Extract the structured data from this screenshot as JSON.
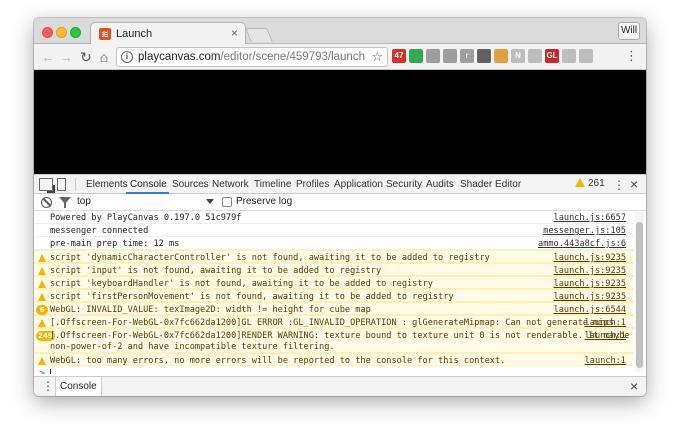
{
  "window": {
    "tab_title": "Launch",
    "tab_close": "×",
    "favicon_glyph": "≋",
    "profile_name": "Will"
  },
  "toolbar": {
    "back_glyph": "←",
    "forward_glyph": "→",
    "reload_glyph": "↻",
    "home_glyph": "⌂",
    "url_host": "playcanvas.com",
    "url_path": "/editor/scene/459793/launch",
    "star_glyph": "☆",
    "menu_glyph": "⋮",
    "info_glyph": "i",
    "extensions": [
      {
        "name": "gmail-ext-icon",
        "label": "47",
        "color": "#d93025"
      },
      {
        "name": "location-ext-icon",
        "label": "",
        "color": "#34a853"
      },
      {
        "name": "cast-ext-icon",
        "label": "",
        "color": "#9e9e9e"
      },
      {
        "name": "chat-ext-icon",
        "label": "",
        "color": "#9e9e9e"
      },
      {
        "name": "r-ext-icon",
        "label": "r",
        "color": "#9e9e9e"
      },
      {
        "name": "square-ext-icon",
        "label": "",
        "color": "#616161"
      },
      {
        "name": "speed-ext-icon",
        "label": "",
        "color": "#e0a040"
      },
      {
        "name": "n-ext-icon",
        "label": "N",
        "color": "#bdbdbd"
      },
      {
        "name": "box-ext-icon",
        "label": "",
        "color": "#bdbdbd"
      },
      {
        "name": "gl-ext-icon",
        "label": "GL",
        "color": "#c62828"
      },
      {
        "name": "grid-ext-icon",
        "label": "",
        "color": "#bdbdbd"
      },
      {
        "name": "link-ext-icon",
        "label": "",
        "color": "#bdbdbd"
      }
    ]
  },
  "devtools": {
    "tabs": [
      "Elements",
      "Console",
      "Sources",
      "Network",
      "Timeline",
      "Profiles",
      "Application",
      "Security",
      "Audits",
      "Shader Editor"
    ],
    "active_tab": "Console",
    "warning_count": "261",
    "more_glyph": "⋮",
    "close_glyph": "×"
  },
  "filter": {
    "context": "top",
    "preserve_log_label": "Preserve log"
  },
  "console": {
    "messages": [
      {
        "level": "info",
        "text": "Powered by PlayCanvas 0.197.0 51c979f",
        "source": "launch.js:6657"
      },
      {
        "level": "info",
        "text": "messenger connected",
        "source": "messenger.js:105"
      },
      {
        "level": "info",
        "text": "pre-main prep time: 12 ms",
        "source": "ammo.443a8cf.js:6"
      },
      {
        "level": "warn",
        "text": "script 'dynamicCharacterController' is not found, awaiting it to be added to registry",
        "source": "launch.js:9235"
      },
      {
        "level": "warn",
        "text": "script 'input' is not found, awaiting it to be added to registry",
        "source": "launch.js:9235"
      },
      {
        "level": "warn",
        "text": "script 'keyboardHandler' is not found, awaiting it to be added to registry",
        "source": "launch.js:9235"
      },
      {
        "level": "warn",
        "text": "script 'firstPersonMovement' is not found, awaiting it to be added to registry",
        "source": "launch.js:9235"
      },
      {
        "level": "warn",
        "badge": "6",
        "text": "WebGL: INVALID_VALUE: texImage2D: width != height for cube map",
        "source": "launch.js:6544"
      },
      {
        "level": "warn",
        "text": "[.Offscreen-For-WebGL-0x7fc662da1200]GL ERROR :GL_INVALID_OPERATION : glGenerateMipmap: Can not generate mips",
        "source": "launch:1"
      },
      {
        "level": "warn",
        "badge": "249",
        "text": "[.Offscreen-For-WebGL-0x7fc662da1200]RENDER WARNING: texture bound to texture unit 0 is not renderable. It maybe\nnon-power-of-2 and have incompatible texture filtering.",
        "source": "launch:1"
      },
      {
        "level": "warn",
        "text": "WebGL: too many errors, no more errors will be reported to the console for this context.",
        "source": "launch:1"
      }
    ],
    "prompt_glyph": ">"
  },
  "drawer": {
    "menu_glyph": "⋮",
    "tab_label": "Console",
    "close_glyph": "×"
  }
}
